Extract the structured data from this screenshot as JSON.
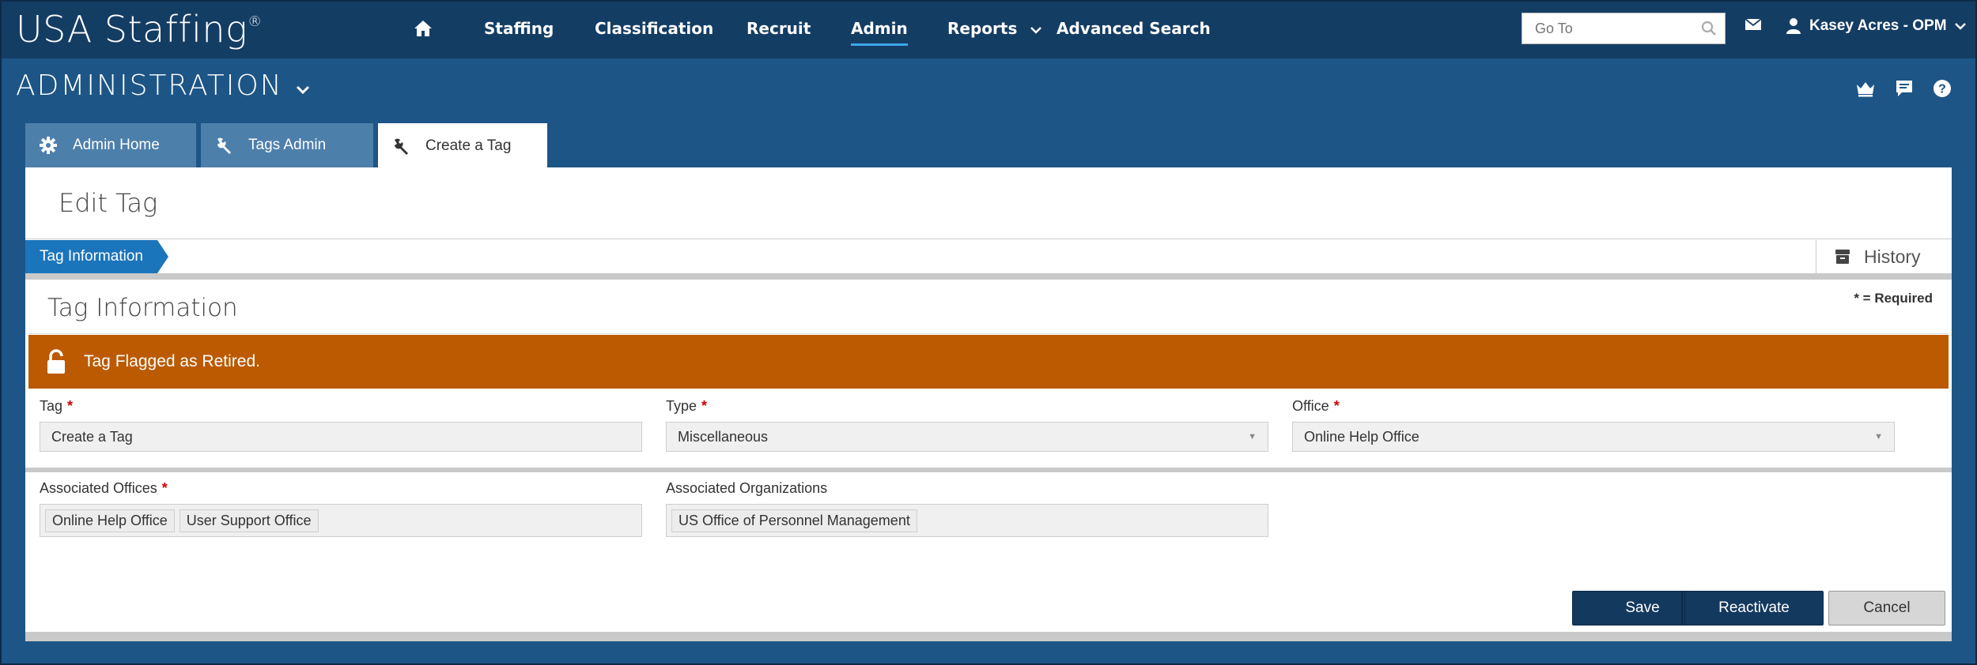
{
  "app": {
    "logo": "USA Staffing",
    "logo_mark": "®"
  },
  "nav": {
    "items": [
      {
        "label": "Staffing"
      },
      {
        "label": "Classification"
      },
      {
        "label": "Recruit"
      },
      {
        "label": "Admin"
      },
      {
        "label": "Reports"
      },
      {
        "label": "Advanced Search"
      }
    ],
    "active": "Admin",
    "goto_placeholder": "Go To",
    "user": "Kasey Acres - OPM"
  },
  "header": {
    "title": "ADMINISTRATION"
  },
  "tabs": [
    {
      "label": "Admin Home",
      "icon": "gear-icon"
    },
    {
      "label": "Tags Admin",
      "icon": "wrench-icon"
    },
    {
      "label": "Create a Tag",
      "icon": "wrench-icon",
      "active": true
    }
  ],
  "page": {
    "title": "Edit Tag",
    "step": "Tag Information",
    "history": "History"
  },
  "section": {
    "title": "Tag Information",
    "required_note": "* = Required",
    "alert": "Tag Flagged as Retired.",
    "fields": {
      "tag": {
        "label": "Tag",
        "value": "Create a Tag",
        "required": true
      },
      "type": {
        "label": "Type",
        "value": "Miscellaneous",
        "required": true
      },
      "office": {
        "label": "Office",
        "value": "Online Help Office",
        "required": true
      },
      "associated_offices": {
        "label": "Associated Offices",
        "values": [
          "Online Help Office",
          "User Support Office"
        ],
        "required": true
      },
      "associated_orgs": {
        "label": "Associated Organizations",
        "values": [
          "US Office of Personnel Management"
        ],
        "required": false
      }
    }
  },
  "buttons": {
    "save": "Save",
    "reactivate": "Reactivate",
    "cancel": "Cancel"
  },
  "colors": {
    "nav_bg": "#143d64",
    "page_bg": "#1d5586",
    "alert": "#bb5a00",
    "step": "#1b75bb",
    "primary_btn": "#13395e"
  }
}
